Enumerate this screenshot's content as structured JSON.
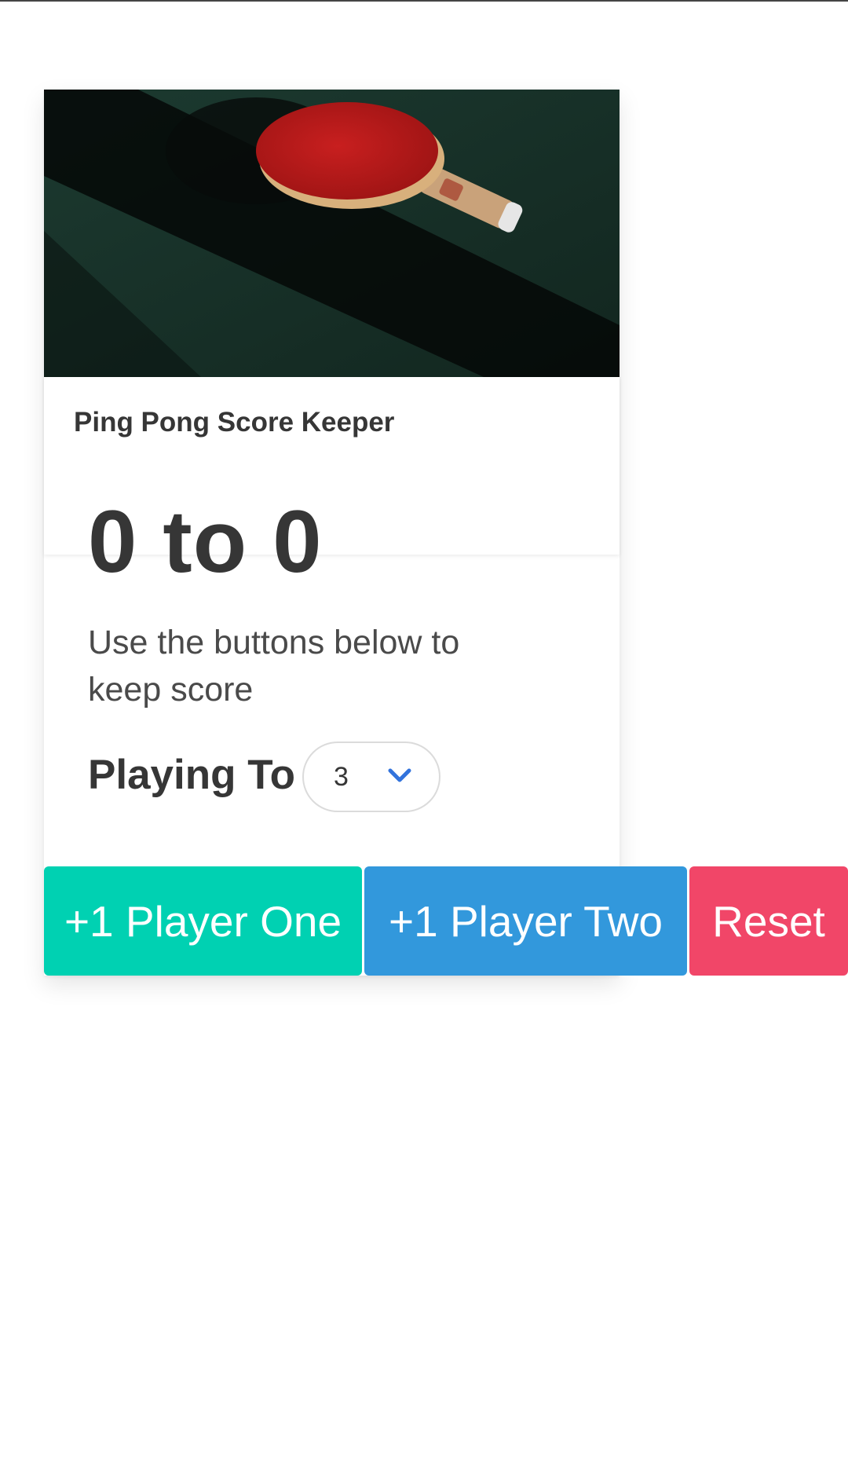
{
  "card": {
    "image_alt": "ping pong paddle on table",
    "title": "Ping Pong Score Keeper"
  },
  "score": {
    "text": "0 to 0"
  },
  "subtitle": "Use the buttons below to keep score",
  "playing_to": {
    "label": "Playing To",
    "selected": "3"
  },
  "buttons": {
    "player_one": "+1 Player One",
    "player_two": "+1 Player Two",
    "reset": "Reset"
  },
  "colors": {
    "player_one": "#00d1b2",
    "player_two": "#3298dc",
    "reset": "#f14668",
    "text": "#363636"
  }
}
